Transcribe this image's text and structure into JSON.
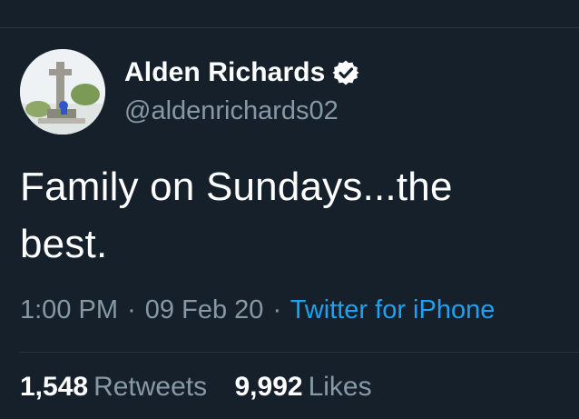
{
  "tweet": {
    "author": {
      "display_name": "Alden Richards",
      "handle": "@aldenrichards02",
      "verified": true,
      "avatar_icon": "profile-photo"
    },
    "text_line1": "Family on Sundays...the",
    "text_line2": "best.",
    "meta": {
      "time": "1:00 PM",
      "date": "09 Feb 20",
      "source": "Twitter for iPhone",
      "separator": "·"
    },
    "stats": {
      "retweets_count": "1,548",
      "retweets_label": "Retweets",
      "likes_count": "9,992",
      "likes_label": "Likes"
    }
  },
  "colors": {
    "background": "#15202b",
    "text_primary": "#ffffff",
    "text_secondary": "#8899a6",
    "link": "#1da1f2",
    "divider": "#2a3540"
  }
}
